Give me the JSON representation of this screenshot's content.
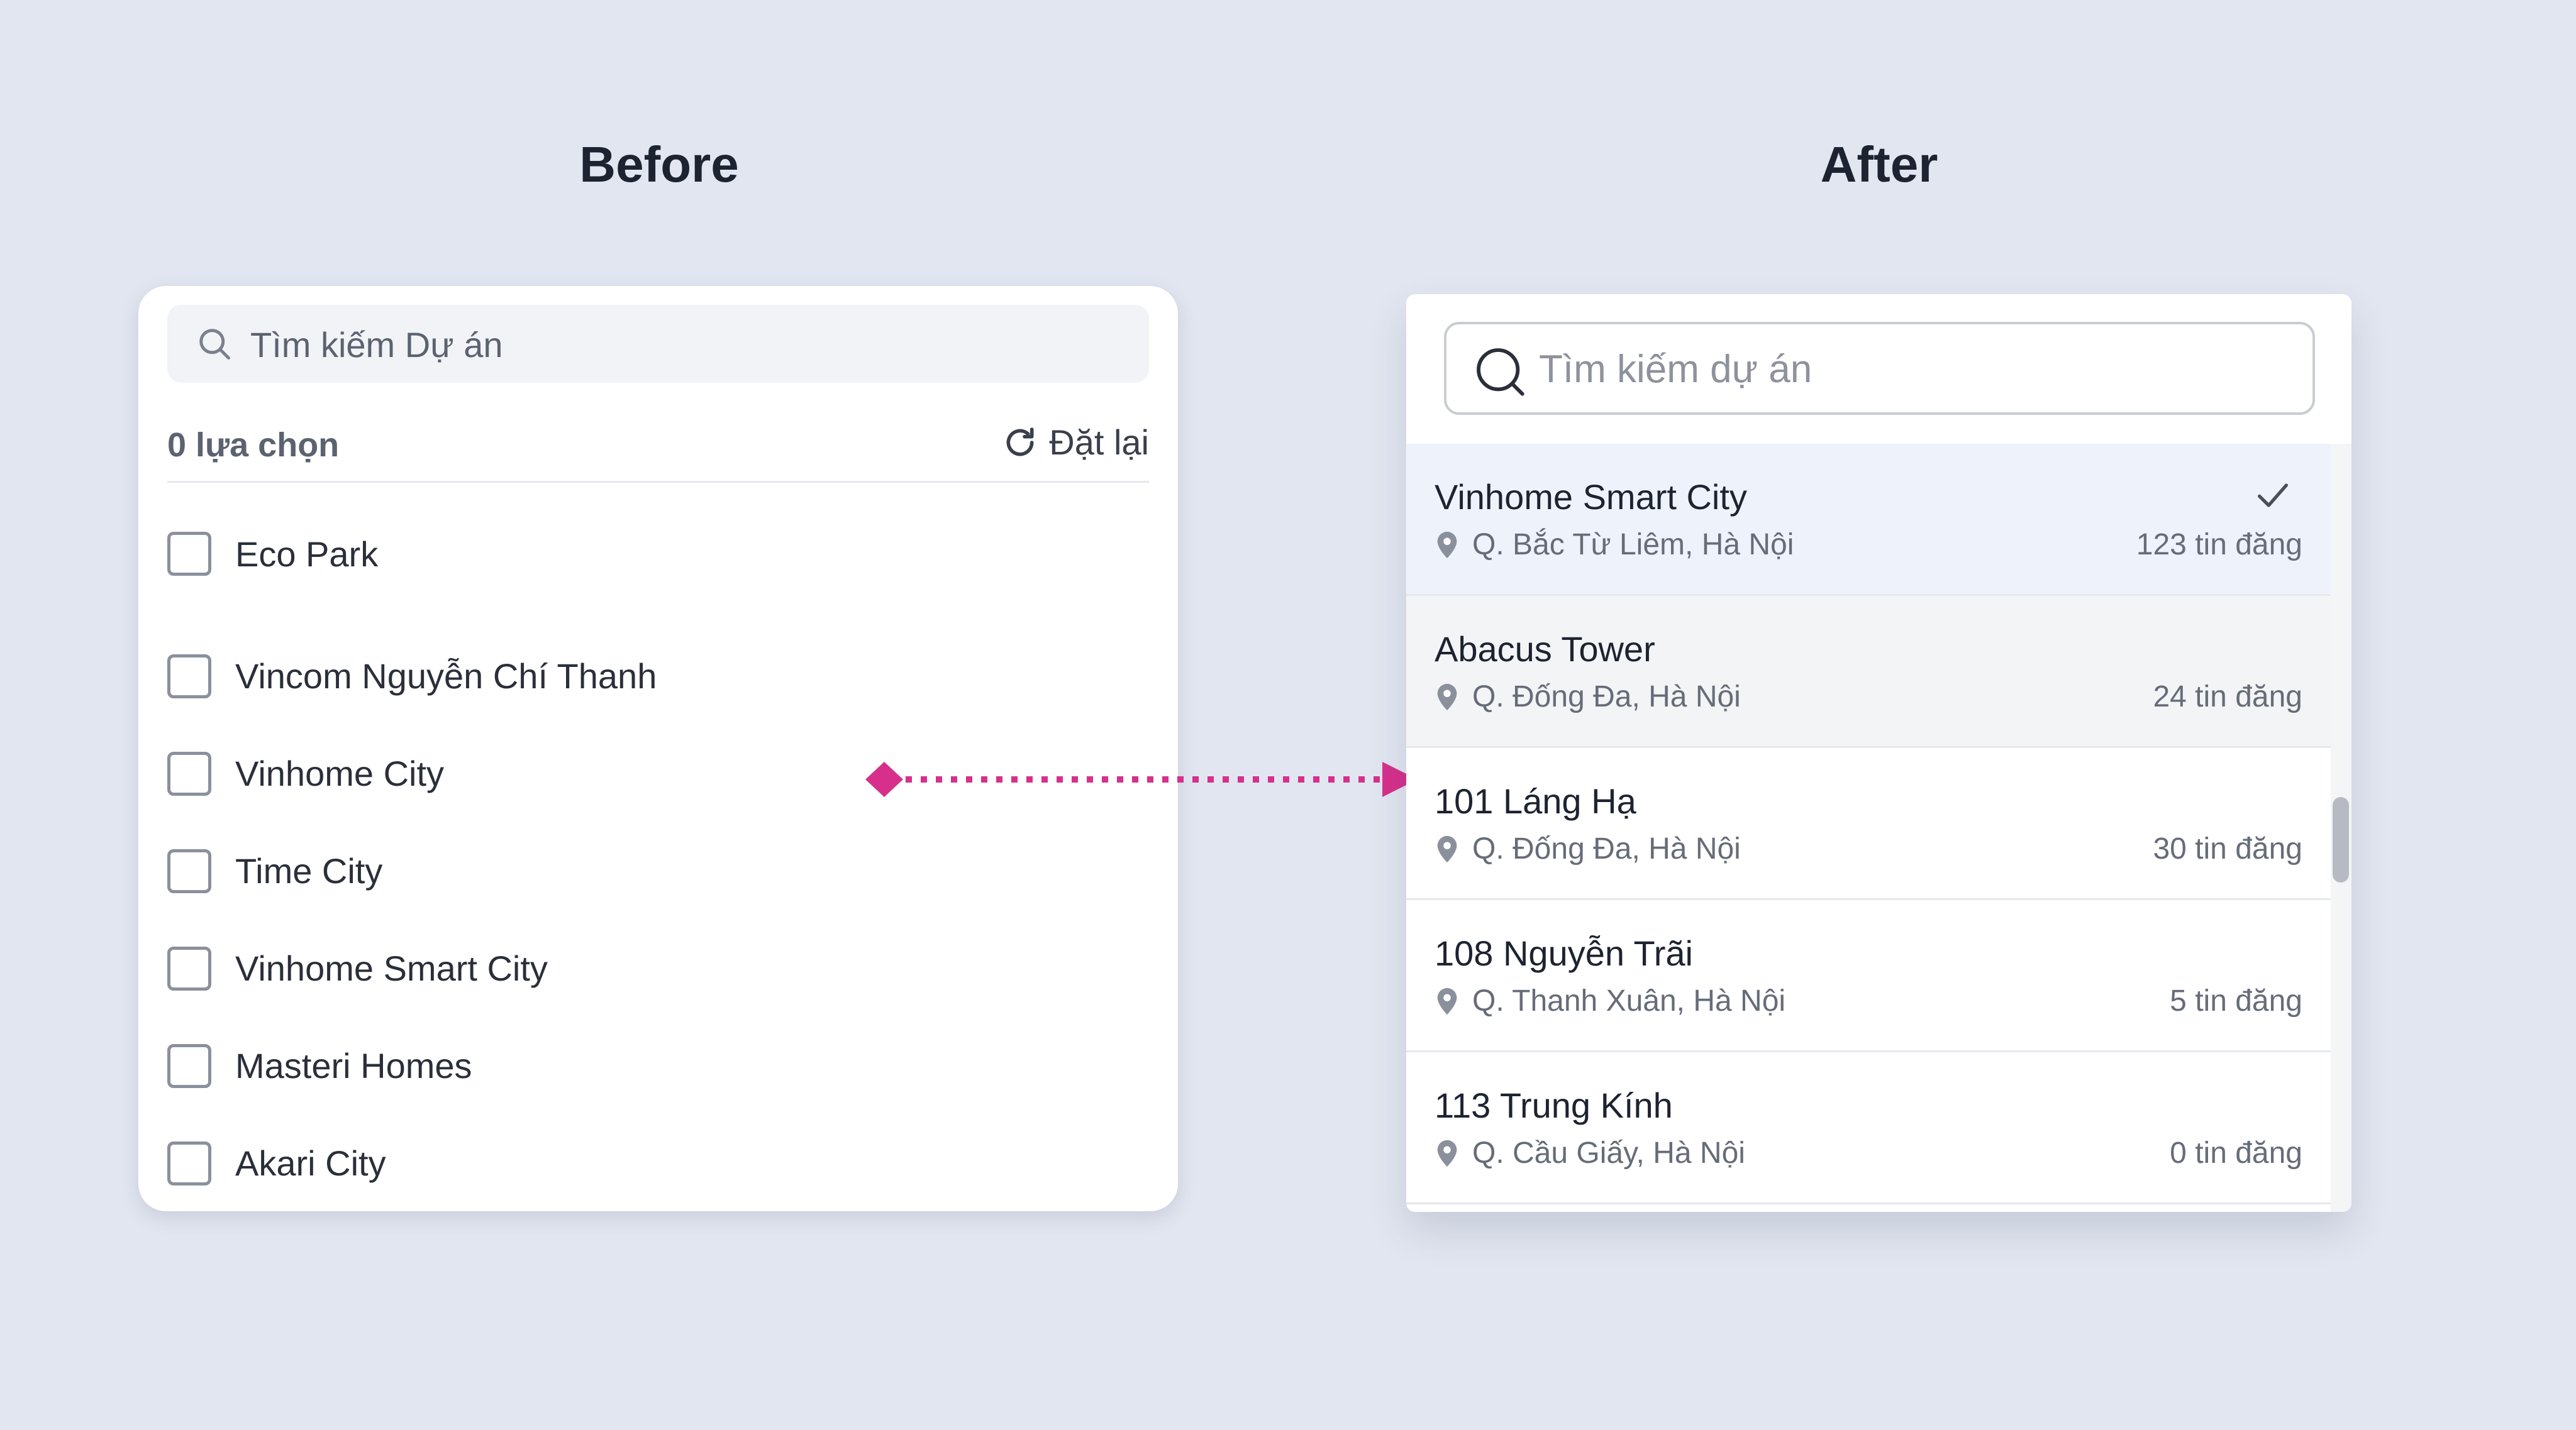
{
  "headings": {
    "before": "Before",
    "after": "After"
  },
  "before": {
    "search_placeholder": "Tìm kiếm Dự án",
    "selection_count": "0 lựa chọn",
    "reset_label": "Đặt lại",
    "items": [
      "Eco Park",
      "Vincom Nguyễn Chí Thanh",
      "Vinhome City",
      "Time City",
      "Vinhome Smart City",
      "Masteri Homes",
      "Akari City"
    ]
  },
  "after": {
    "search_placeholder": "Tìm kiếm dự án",
    "items": [
      {
        "name": "Vinhome Smart City",
        "location": "Q. Bắc Từ Liêm, Hà Nội",
        "count": "123 tin đăng",
        "state": "selected"
      },
      {
        "name": "Abacus Tower",
        "location": "Q. Đống Đa, Hà Nội",
        "count": "24 tin đăng",
        "state": "hover"
      },
      {
        "name": "101 Láng Hạ",
        "location": "Q. Đống Đa, Hà Nội",
        "count": "30 tin đăng",
        "state": "default"
      },
      {
        "name": "108 Nguyễn Trãi",
        "location": "Q. Thanh Xuân, Hà Nội",
        "count": "5 tin đăng",
        "state": "default"
      },
      {
        "name": "113 Trung Kính",
        "location": "Q. Cầu Giấy, Hà Nội",
        "count": "0 tin đăng",
        "state": "default"
      }
    ]
  },
  "icons": {
    "search": "search-icon",
    "reset": "refresh-icon",
    "location": "map-pin-icon",
    "check": "checkmark-icon"
  },
  "colors": {
    "background": "#e1e6f0",
    "accent_arrow": "#d6308c",
    "selected_row": "#eef3fb",
    "hover_row": "#f3f4f6"
  }
}
